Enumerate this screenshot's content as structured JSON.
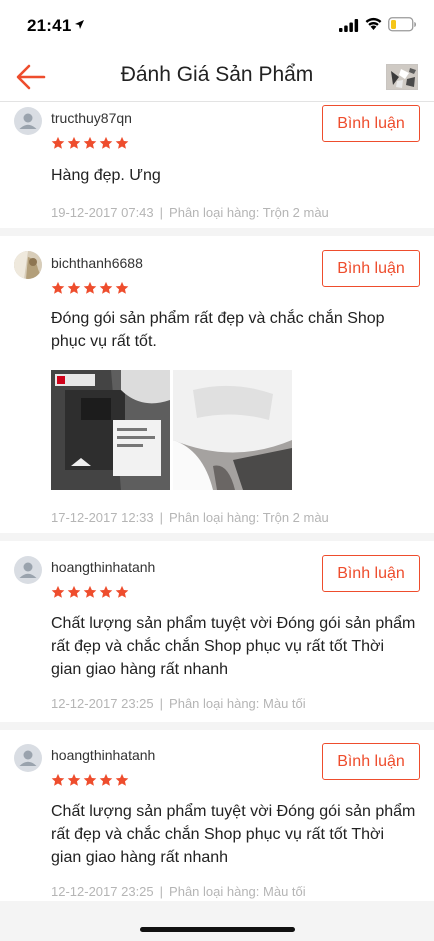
{
  "status_bar": {
    "time": "21:41"
  },
  "header": {
    "title": "Đánh Giá Sản Phẩm",
    "back_icon": "back-arrow-icon",
    "accent_color": "#ee4d2d"
  },
  "reviews": [
    {
      "username": "tructhuy87qn",
      "rating": 5,
      "reply_label": "Bình luận",
      "text": "Hàng đẹp. Ưng",
      "date": "19-12-2017 07:43",
      "variant_label": "Phân loại hàng:",
      "variant": "Trộn 2 màu"
    },
    {
      "username": "bichthanh6688",
      "rating": 5,
      "reply_label": "Bình luận",
      "text": "Đóng gói sản phẩm rất đẹp và chắc chắn Shop phục vụ rất tốt.",
      "date": "17-12-2017 12:33",
      "variant_label": "Phân loại hàng:",
      "variant": "Trộn 2 màu"
    },
    {
      "username": "hoangthinhatanh",
      "rating": 5,
      "reply_label": "Bình luận",
      "text": "Chất lượng sản phẩm tuyệt vời Đóng gói sản phẩm rất đẹp và chắc chắn Shop phục vụ rất tốt Thời gian giao hàng rất nhanh",
      "date": "12-12-2017 23:25",
      "variant_label": "Phân loại hàng:",
      "variant": "Màu tối"
    },
    {
      "username": "hoangthinhatanh",
      "rating": 5,
      "reply_label": "Bình luận",
      "text": "Chất lượng sản phẩm tuyệt vời Đóng gói sản phẩm rất đẹp và chắc chắn Shop phục vụ rất tốt Thời gian giao hàng rất nhanh",
      "date": "12-12-2017 23:25",
      "variant_label": "Phân loại hàng:",
      "variant": "Màu tối"
    }
  ]
}
